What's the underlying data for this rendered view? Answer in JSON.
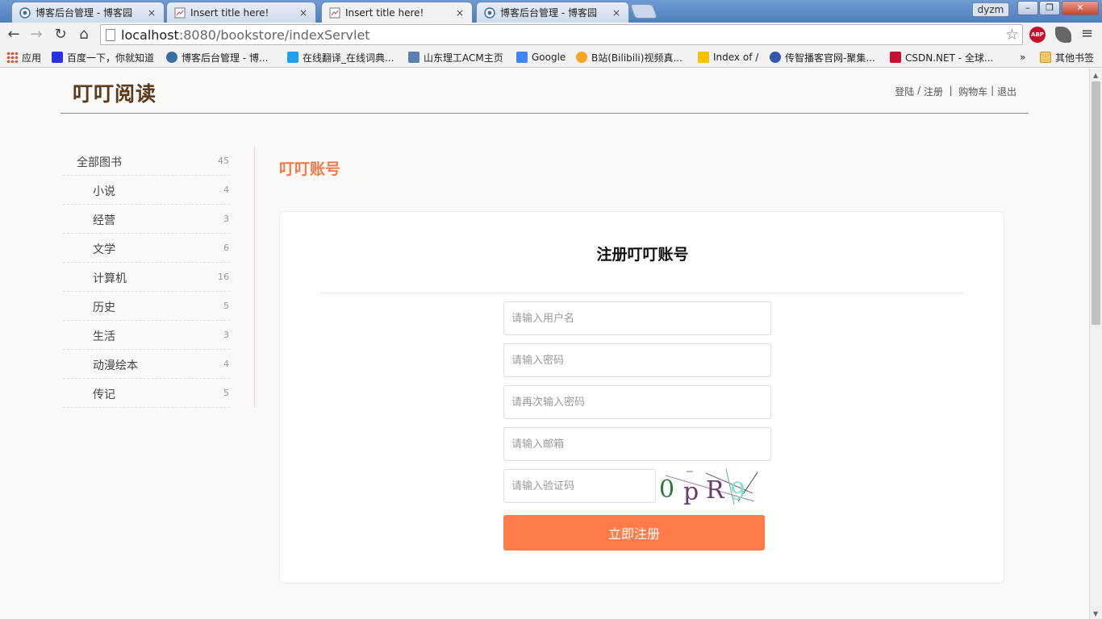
{
  "browser": {
    "tabs": [
      {
        "title": "博客后台管理 - 博客园",
        "icon": "cnblogs-icon",
        "active": false
      },
      {
        "title": "Insert title here!",
        "icon": "page-icon",
        "active": false
      },
      {
        "title": "Insert title here!",
        "icon": "page-icon",
        "active": true
      },
      {
        "title": "博客后台管理 - 博客园",
        "icon": "cnblogs-icon",
        "active": false
      }
    ],
    "tab_close": "×",
    "user": "dyzm",
    "window_buttons": {
      "minimize": "–",
      "maximize": "❐",
      "close": "✕"
    },
    "nav": {
      "back": "←",
      "forward": "→",
      "reload": "↻",
      "home": "⌂"
    },
    "url_host": "localhost",
    "url_path": ":8080/bookstore/indexServlet",
    "bookmark_star": "☆",
    "abp_label": "ABP",
    "menu": "≡",
    "bookmarks": [
      {
        "label": "应用",
        "color": "#e94b35"
      },
      {
        "label": "百度一下，你就知道",
        "color": "#2932e1"
      },
      {
        "label": "博客后台管理 - 博...",
        "color": "#3a6ea5"
      },
      {
        "label": "在线翻译_在线词典...",
        "color": "#1fa0e8"
      },
      {
        "label": "山东理工ACM主页",
        "color": "#5a7fb0"
      },
      {
        "label": "Google",
        "color": "#4285f4"
      },
      {
        "label": "B站(Bilibili)视频真...",
        "color": "#f5a623"
      },
      {
        "label": "Index of /",
        "color": "#f3c300"
      },
      {
        "label": "传智播客官网-聚集...",
        "color": "#3355aa"
      },
      {
        "label": "CSDN.NET - 全球...",
        "color": "#c8102e"
      }
    ],
    "bookmarks_more": "»",
    "other_bookmarks": "其他书签"
  },
  "site": {
    "logo": "叮叮阅读",
    "links": {
      "login": "登陆",
      "sep1": " / ",
      "register": "注册",
      "sep2": "  |  ",
      "cart": "购物车",
      "sep3": " | ",
      "logout": "退出"
    }
  },
  "categories": [
    {
      "name": "全部图书",
      "count": "45"
    },
    {
      "name": "小说",
      "count": "4"
    },
    {
      "name": "经营",
      "count": "3"
    },
    {
      "name": "文学",
      "count": "6"
    },
    {
      "name": "计算机",
      "count": "16"
    },
    {
      "name": "历史",
      "count": "5"
    },
    {
      "name": "生活",
      "count": "3"
    },
    {
      "name": "动漫绘本",
      "count": "4"
    },
    {
      "name": "传记",
      "count": "5"
    }
  ],
  "section_title": "叮叮账号",
  "form": {
    "title": "注册叮叮账号",
    "username_placeholder": "请输入用户名",
    "password_placeholder": "请输入密码",
    "password_confirm_placeholder": "请再次输入密码",
    "email_placeholder": "请输入邮箱",
    "captcha_placeholder": "请输入验证码",
    "captcha_text": [
      "0",
      "p",
      "R",
      "9"
    ],
    "submit_label": "立即注册"
  },
  "colors": {
    "accent": "#ff7b49",
    "logo": "#5b3a1d",
    "section_title": "#f07a49"
  }
}
